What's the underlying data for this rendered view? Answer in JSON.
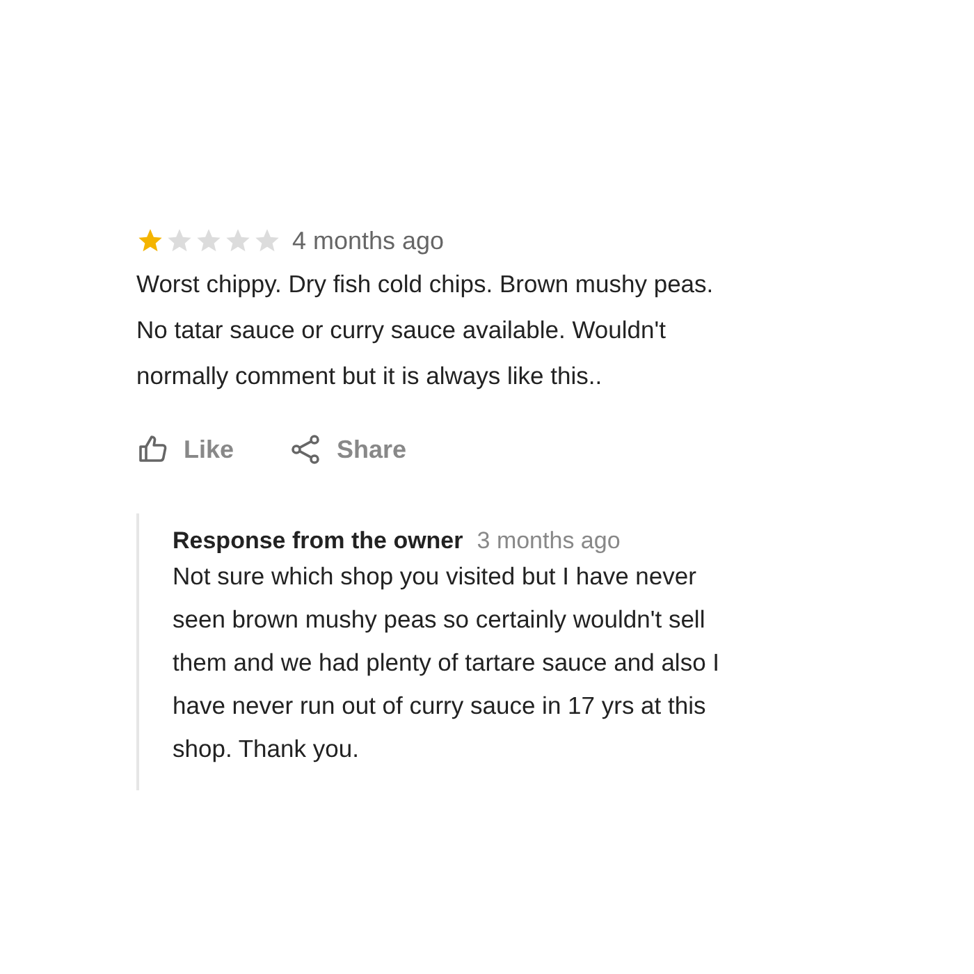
{
  "review": {
    "stars": 1,
    "time": "4 months ago",
    "text": "Worst chippy. Dry fish cold chips. Brown mushy peas.\nNo tatar sauce or curry sauce available. Wouldn't\nnormally comment but it is always like this.."
  },
  "actions": [
    {
      "kind": "like",
      "label": "Like"
    },
    {
      "kind": "share",
      "label": "Share"
    }
  ],
  "response": {
    "title": "Response from the owner",
    "time": "3 months ago",
    "text": "Not sure which shop you visited but I have never\nseen brown mushy peas so certainly wouldn't sell\nthem and we had plenty of tartare sauce and also I\nhave never run out of curry sauce in 17 yrs at this\nshop. Thank you."
  }
}
